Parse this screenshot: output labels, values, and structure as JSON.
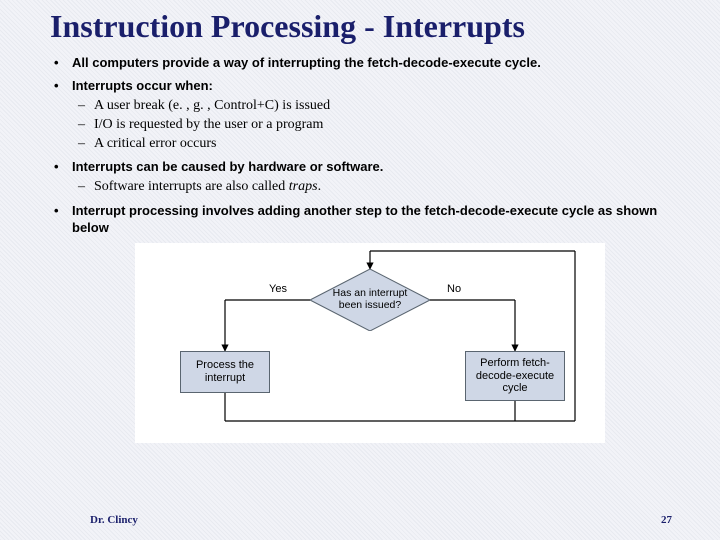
{
  "title": "Instruction Processing - Interrupts",
  "bullets": {
    "b1": "All computers provide a way of interrupting the fetch-decode-execute cycle.",
    "b2": "Interrupts occur when:",
    "b2s1": "A user break (e. , g. , Control+C) is issued",
    "b2s2": "I/O is requested by the user or a program",
    "b2s3": "A critical error occurs",
    "b3": "Interrupts can be caused by hardware or software.",
    "b3s1_a": "Software interrupts are also called ",
    "b3s1_b": "traps",
    "b3s1_c": ".",
    "b4": "Interrupt processing involves adding another step to the fetch-decode-execute cycle as shown below"
  },
  "diagram": {
    "decision": "Has an interrupt been issued?",
    "yes": "Yes",
    "no": "No",
    "left_box": "Process the interrupt",
    "right_box": "Perform fetch-decode-execute cycle"
  },
  "footer": {
    "author": "Dr. Clincy",
    "page": "27"
  }
}
